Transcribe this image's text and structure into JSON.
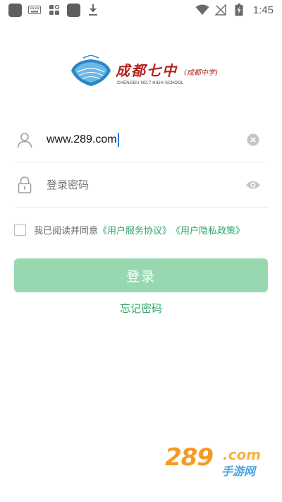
{
  "status_bar": {
    "time": "1:45",
    "icons": [
      "app-icon",
      "keyboard-icon",
      "grid-icon",
      "app-icon",
      "download-icon",
      "wifi-icon",
      "no-signal-icon",
      "battery-icon"
    ]
  },
  "logo": {
    "emblem_text": "成都七中",
    "name_cn": "成都七中",
    "name_cn_sub": "(成都中学)",
    "name_en": "CHENGDU NO.7 HIGH SCHOOL"
  },
  "form": {
    "username": {
      "value": "www.289.com",
      "icon": "user-icon",
      "action_icon": "clear-icon"
    },
    "password": {
      "placeholder": "登录密码",
      "icon": "lock-icon",
      "action_icon": "eye-icon"
    }
  },
  "agreement": {
    "prefix": "我已阅读并同意",
    "terms_link": "《用户服务协议》",
    "privacy_link": "《用户隐私政策》",
    "checked": false
  },
  "actions": {
    "login_label": "登录",
    "forgot_label": "忘记密码"
  },
  "watermark": {
    "number": "289",
    "domain": ".com",
    "text": "手游网"
  },
  "colors": {
    "accent": "#2ea56a",
    "button_bg": "#98d8b1",
    "logo_red": "#b3241e"
  }
}
